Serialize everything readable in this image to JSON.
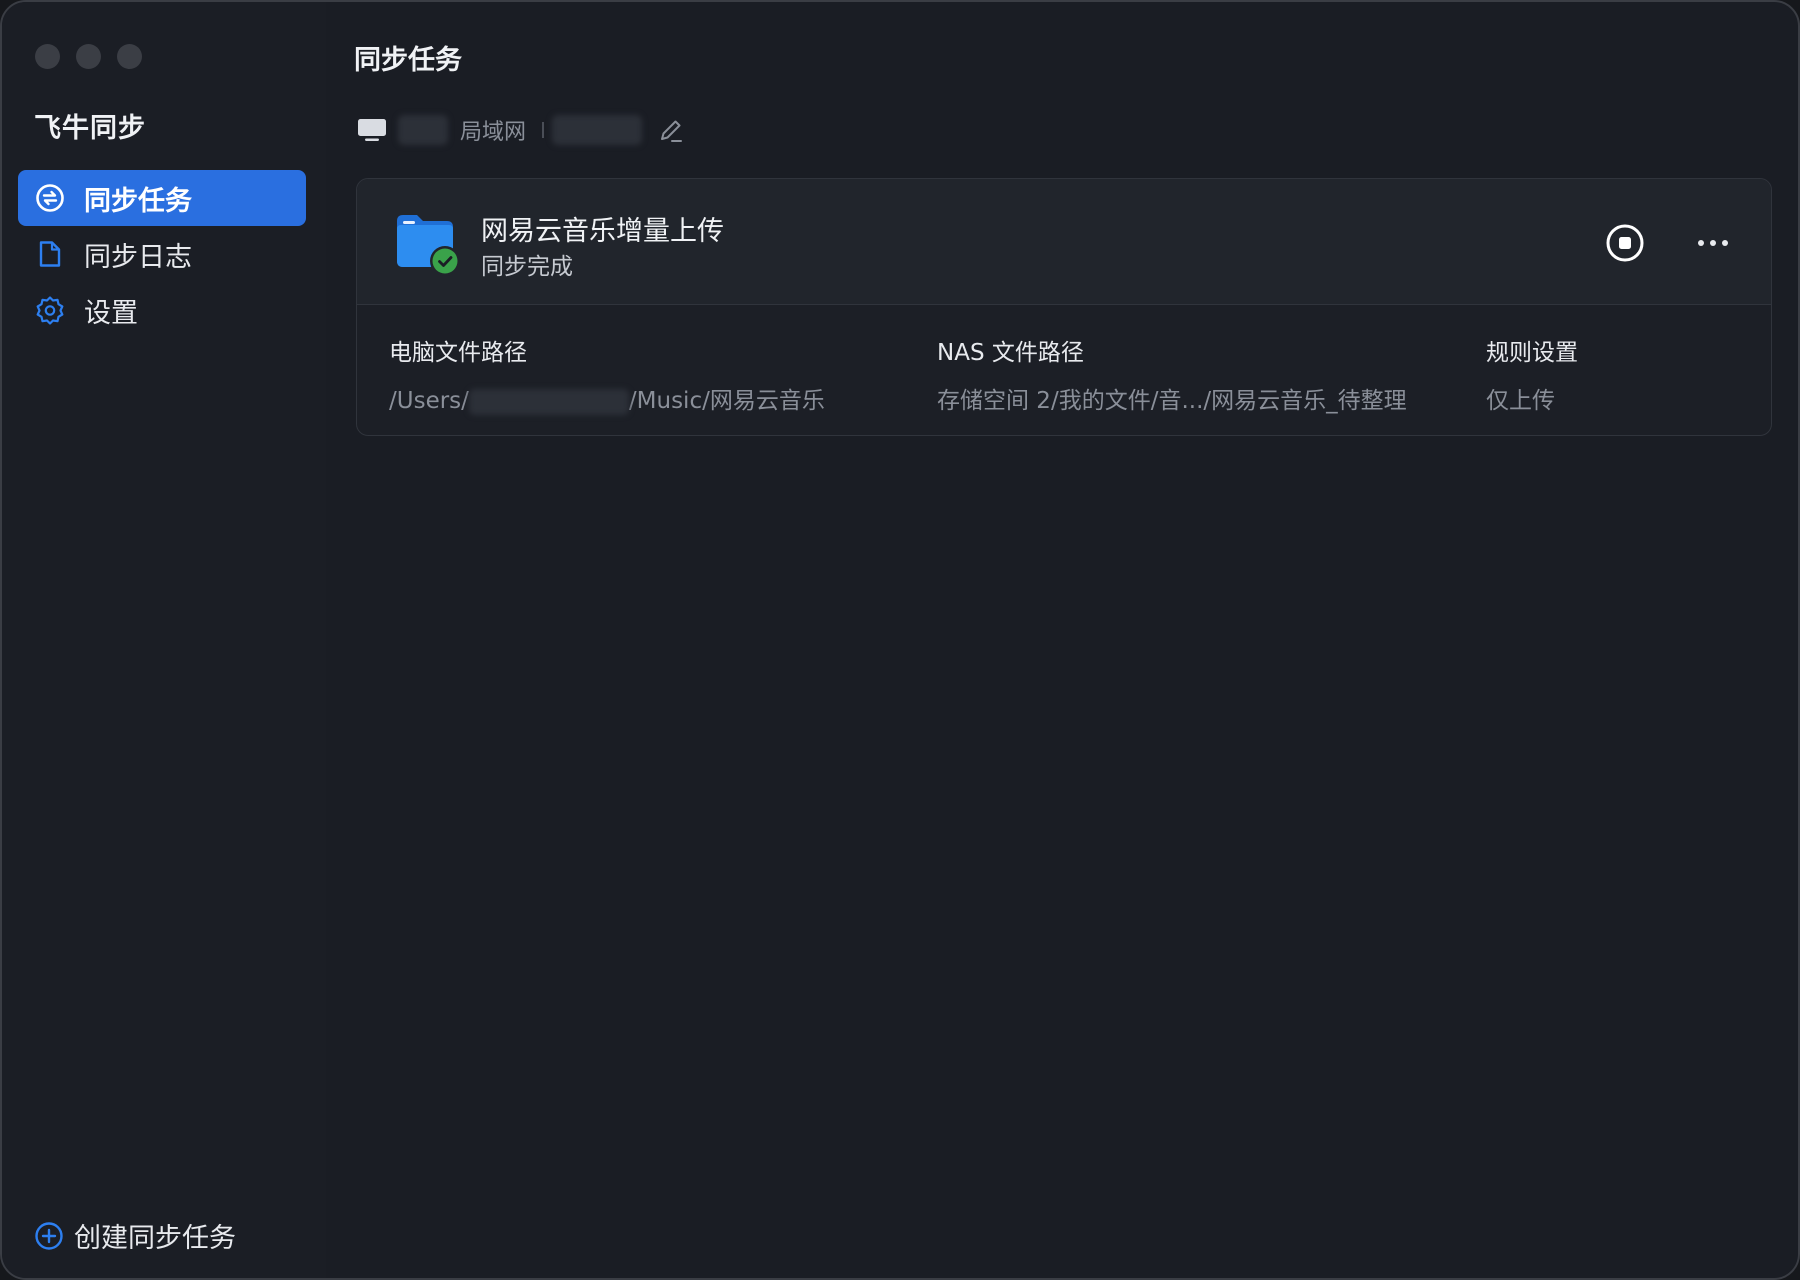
{
  "app": {
    "title": "飞牛同步"
  },
  "sidebar": {
    "items": [
      {
        "label": "同步任务",
        "icon": "sync-icon",
        "active": true
      },
      {
        "label": "同步日志",
        "icon": "document-icon",
        "active": false
      },
      {
        "label": "设置",
        "icon": "gear-icon",
        "active": false
      }
    ],
    "create_label": "创建同步任务"
  },
  "main": {
    "title": "同步任务",
    "device": {
      "network": "局域网"
    },
    "task": {
      "name": "网易云音乐增量上传",
      "status": "同步完成",
      "columns": [
        {
          "label": "电脑文件路径",
          "value_prefix": "/Users/",
          "value_suffix": "/Music/网易云音乐"
        },
        {
          "label": "NAS 文件路径",
          "value": "存储空间 2/我的文件/音.../网易云音乐_待整理"
        },
        {
          "label": "规则设置",
          "value": "仅上传"
        }
      ]
    }
  },
  "colors": {
    "accent": "#2a6fe0",
    "success": "#3aa24a",
    "folder": "#2d8df0"
  }
}
